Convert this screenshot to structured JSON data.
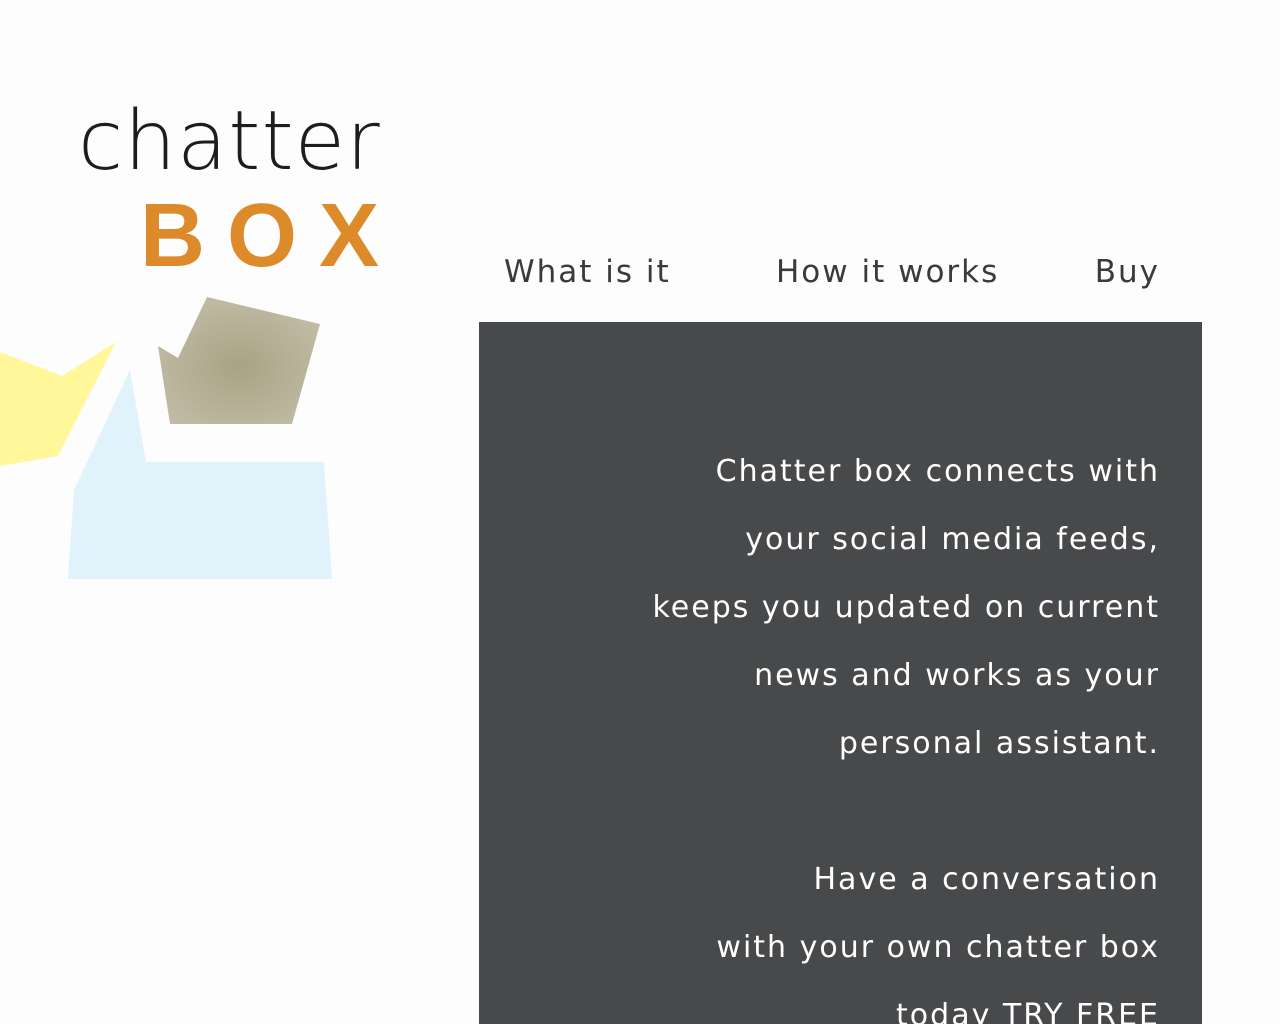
{
  "logo": {
    "word_top": "chatter",
    "word_bottom": "BOX",
    "colors": {
      "dark": "#1d1d1d",
      "orange": "#dd8a2a",
      "yellow": "#fff79a",
      "khaki": "#b8b197",
      "light_blue": "#e0f3fa"
    }
  },
  "nav": {
    "items": [
      {
        "label": "What is it"
      },
      {
        "label": "How it works"
      },
      {
        "label": "Buy"
      }
    ]
  },
  "panel": {
    "background": "#48494b",
    "paragraph1": [
      "Chatter box connects with",
      "your social media feeds,",
      "keeps you updated on current",
      "news and works as your",
      "personal assistant."
    ],
    "paragraph2": [
      "Have a conversation",
      "with your own chatter box",
      "today TRY FREE"
    ]
  }
}
